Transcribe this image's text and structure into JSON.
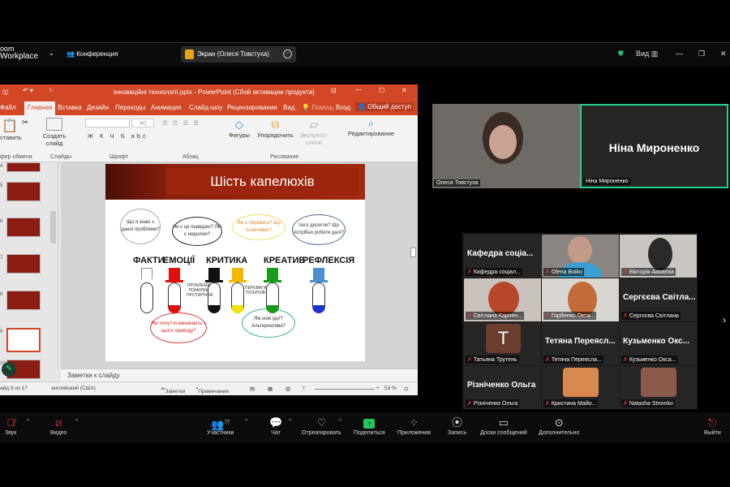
{
  "topbar": {
    "app_line1": "oom",
    "app_line2": "Workplace",
    "meeting_label": "Конференция",
    "share_label": "Экран (Олеся Товстуха)",
    "view_label": "Вид"
  },
  "ppt": {
    "title": "інноваційні технології.pptx - PowerPoint (Сбой активации продукта)",
    "tabs": [
      "Файл",
      "Главная",
      "Вставка",
      "Дизайн",
      "Переходы",
      "Анимация",
      "Слайд-шоу",
      "Рецензирование",
      "Вид",
      "Помощ",
      "Вход",
      "Общий доступ"
    ],
    "ribbon": {
      "paste": "ставить",
      "new_slide": "Создать слайд",
      "font_size": "40",
      "shapes": "Фигуры",
      "arrange": "Упорядочить",
      "styles": "Экспресс-стили",
      "editing": "Редактирование",
      "groups": [
        "фер обмена",
        "Слайды",
        "Шрифт",
        "Абзац",
        "Рисование"
      ]
    },
    "thumb_numbers": [
      "4",
      "5",
      "6",
      "7",
      "8",
      "9",
      "10"
    ],
    "slide": {
      "title": "Шість капелюхів",
      "hats": [
        {
          "label": "ФАКТИ",
          "color": "#ffffff"
        },
        {
          "label": "ЕМОЦІЇ",
          "color": "#e01010"
        },
        {
          "label": "КРИТИКА",
          "color": "#111111"
        },
        {
          "label": "",
          "color": "#f2b800"
        },
        {
          "label": "КРЕАТИВ",
          "color": "#1a9a1a"
        },
        {
          "label": "РЕФЛЕКСІЯ",
          "color": "#4b8fd0"
        }
      ],
      "clouds": [
        "Що я знаю з даної проблеми?",
        "Чи є це правдою? Які є недоліки?",
        "Які є переваги? Що позитивне?",
        "Чого досягли? Що потрібно робити далі?",
        "Які почуття виникають з цього приводу?",
        "Які нові ідеї? Альтернатива?"
      ],
      "small_notes": [
        "ПРОБЛЕМИ ПОМИЛКИ ПРОТИРІЧЧЯ",
        "ПЕРЕВАГИ ПОЗИТИВ"
      ]
    },
    "notes_placeholder": "Заметки к слайду",
    "status": {
      "slide": "айд 9 из 17",
      "language": "английский (США)",
      "notes": "Заметки",
      "comments": "Примечания",
      "zoom": "53 %"
    }
  },
  "speakers": [
    {
      "name": "Олеся Товстуха"
    },
    {
      "name": "Ніна Мироненко",
      "big": "Ніна Мироненко"
    }
  ],
  "gallery": [
    {
      "big": "Кафедра соціа...",
      "label": "Кафедра соціал..."
    },
    {
      "big": "",
      "label": "Olena Boiko"
    },
    {
      "big": "",
      "label": "Вікторія Акмаєва"
    },
    {
      "big": "",
      "label": "Світлана Карпен..."
    },
    {
      "big": "",
      "label": "Горбенко Окса..."
    },
    {
      "big": "Сергєєва Світла...",
      "label": "Сергєєва Світлана"
    },
    {
      "big": "T",
      "label": "Татьяна Трутень"
    },
    {
      "big": "Тетяна Переясл...",
      "label": "Тетяна Переясла..."
    },
    {
      "big": "Кузьменко Окс...",
      "label": "Кузьменко Окса..."
    },
    {
      "big": "Різніченко Ольга",
      "label": "Різніченко Ольга"
    },
    {
      "big": "",
      "label": "Кристина Майо..."
    },
    {
      "big": "",
      "label": "Natasha Stromko"
    }
  ],
  "toolbar": {
    "audio": "Звук",
    "video": "Видео",
    "participants": "Участники",
    "participants_count": "77",
    "chat": "Чат",
    "react": "Отреагировать",
    "share": "Поделиться",
    "apps": "Приложения",
    "record": "Запись",
    "whiteboards": "Доски сообщений",
    "more": "Дополнительно",
    "leave": "Выйти"
  },
  "colors": {
    "ppt_accent": "#d24726",
    "zoom_share": "#22c55e",
    "active_speaker": "#23d18b"
  }
}
